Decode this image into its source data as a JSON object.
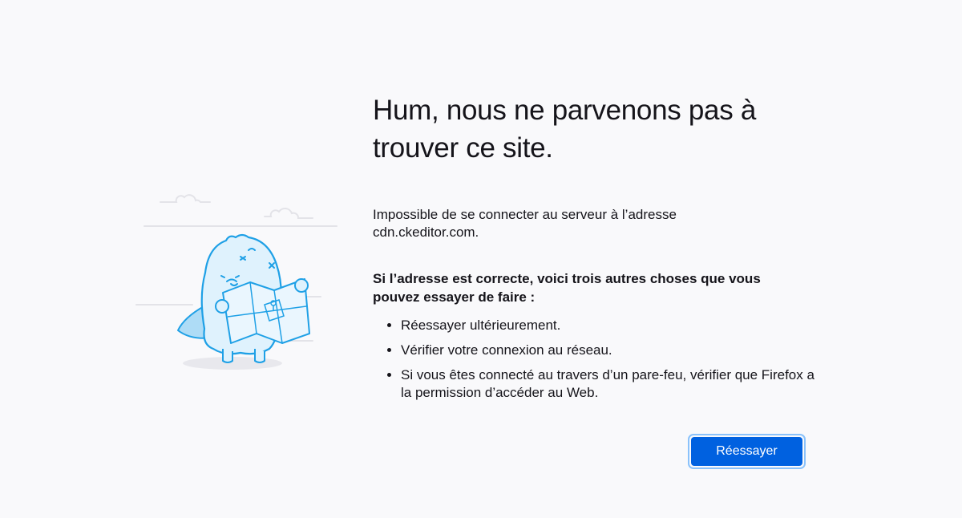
{
  "error": {
    "title": "Hum, nous ne parvenons pas à trouver ce site.",
    "description": "Impossible de se connecter au serveur à l’adresse cdn.ckeditor.com.",
    "suggestions_heading": "Si l’adresse est correcte, voici trois autres choses que vous pouvez essayer de faire :",
    "suggestions": [
      "Réessayer ultérieurement.",
      "Vérifier votre connexion au réseau.",
      "Si vous êtes connecté au travers d’un pare-feu, vérifier que Firefox a la permission d’accéder au Web."
    ],
    "retry_label": "Réessayer"
  },
  "illustration": {
    "icon": "lost-monster-with-map-icon"
  },
  "colors": {
    "background": "#f9f9fb",
    "accent": "#0061e0",
    "focus_ring": "#8ac2fb",
    "illustration_stroke": "#1ea0e6",
    "illustration_fill": "#dff2fd"
  }
}
